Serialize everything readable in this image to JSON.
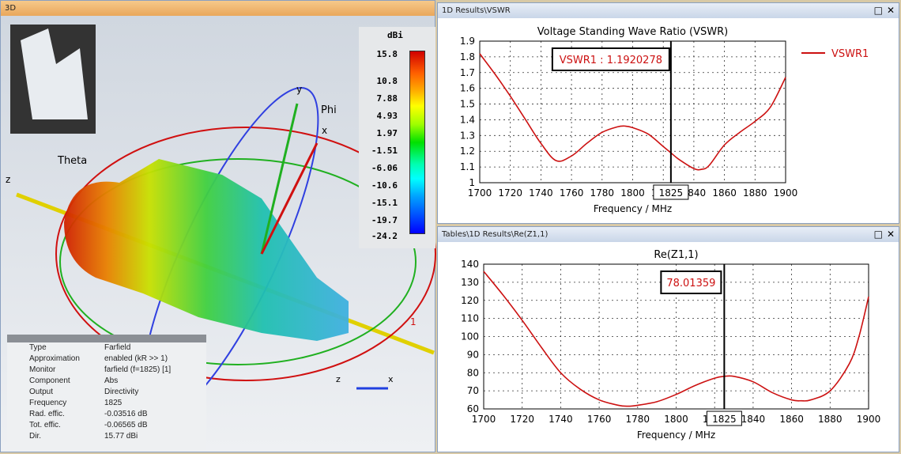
{
  "left_panel": {
    "title": "3D",
    "axes": {
      "theta": "Theta",
      "phi": "Phi",
      "x": "x",
      "y": "y",
      "z": "z",
      "port": "1"
    },
    "colorbar": {
      "unit": "dBi",
      "ticks": [
        "15.8",
        "10.8",
        "7.88",
        "4.93",
        "1.97",
        "-1.51",
        "-6.06",
        "-10.6",
        "-15.1",
        "-19.7",
        "-24.2"
      ]
    },
    "info": [
      [
        "Type",
        "Farfield"
      ],
      [
        "Approximation",
        "enabled (kR >> 1)"
      ],
      [
        "Monitor",
        "farfield (f=1825) [1]"
      ],
      [
        "Component",
        "Abs"
      ],
      [
        "Output",
        "Directivity"
      ],
      [
        "Frequency",
        "1825"
      ],
      [
        "Rad. effic.",
        "-0.03516 dB"
      ],
      [
        "Tot. effic.",
        "-0.06565 dB"
      ],
      [
        "Dir.",
        "15.77 dBi"
      ]
    ]
  },
  "window_buttons": {
    "maximize": "□",
    "close": "✕"
  },
  "chart_data": [
    {
      "panel_title": "1D Results\\VSWR",
      "type": "line",
      "title": "Voltage Standing Wave Ratio (VSWR)",
      "xlabel": "Frequency / MHz",
      "ylabel": "",
      "xlim": [
        1700,
        1900
      ],
      "ylim": [
        1,
        1.9
      ],
      "xticks": [
        "1700",
        "1720",
        "1740",
        "1760",
        "1780",
        "1800",
        "1820",
        "1840",
        "1860",
        "1880",
        "1900"
      ],
      "yticks": [
        "1",
        "1.1",
        "1.2",
        "1.3",
        "1.4",
        "1.5",
        "1.6",
        "1.7",
        "1.8",
        "1.9"
      ],
      "series": [
        {
          "name": "VSWR1",
          "color": "#cc1111",
          "x": [
            1700,
            1710,
            1720,
            1730,
            1740,
            1750,
            1760,
            1770,
            1780,
            1790,
            1795,
            1800,
            1810,
            1820,
            1825,
            1830,
            1840,
            1845,
            1850,
            1860,
            1870,
            1880,
            1890,
            1900
          ],
          "y": [
            1.82,
            1.69,
            1.55,
            1.4,
            1.25,
            1.14,
            1.17,
            1.25,
            1.32,
            1.355,
            1.36,
            1.35,
            1.31,
            1.23,
            1.19,
            1.15,
            1.09,
            1.085,
            1.11,
            1.24,
            1.32,
            1.39,
            1.48,
            1.67
          ]
        }
      ],
      "legend": "top-right",
      "marker": {
        "x": 1825,
        "x_label": "1825",
        "label": "VSWR1 : 1.1920278"
      }
    },
    {
      "panel_title": "Tables\\1D Results\\Re(Z1,1)",
      "type": "line",
      "title": "Re(Z1,1)",
      "xlabel": "Frequency / MHz",
      "ylabel": "",
      "xlim": [
        1700,
        1900
      ],
      "ylim": [
        60,
        140
      ],
      "xticks": [
        "1700",
        "1720",
        "1740",
        "1760",
        "1780",
        "1800",
        "1820",
        "1840",
        "1860",
        "1880",
        "1900"
      ],
      "yticks": [
        "60",
        "70",
        "80",
        "90",
        "100",
        "110",
        "120",
        "130",
        "140"
      ],
      "series": [
        {
          "name": "Re(Z1,1)",
          "color": "#cc1111",
          "x": [
            1700,
            1710,
            1720,
            1730,
            1740,
            1750,
            1760,
            1770,
            1775,
            1780,
            1790,
            1800,
            1810,
            1820,
            1825,
            1830,
            1840,
            1850,
            1860,
            1865,
            1870,
            1880,
            1890,
            1895,
            1900
          ],
          "y": [
            136,
            123,
            109,
            94,
            80,
            71,
            65,
            62,
            61.5,
            62,
            64,
            68,
            73,
            77,
            78,
            78,
            75,
            69,
            65,
            64.5,
            65,
            70,
            85,
            100,
            122
          ]
        }
      ],
      "marker": {
        "x": 1825,
        "x_label": "1825",
        "label": "78.01359"
      }
    }
  ]
}
